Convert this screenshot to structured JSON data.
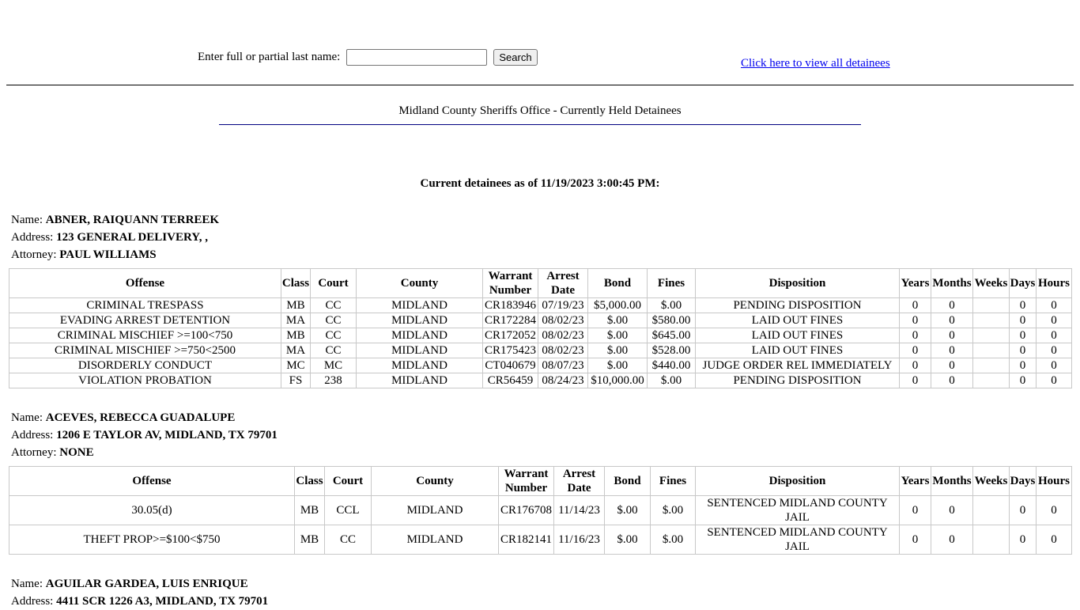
{
  "search": {
    "label": "Enter full or partial last name:",
    "value": "",
    "button": "Search"
  },
  "view_all_link": "Click here to view all detainees",
  "page_title": "Midland County Sheriffs Office - Currently Held Detainees",
  "as_of": "Current detainees as of 11/19/2023 3:00:45 PM:",
  "labels": {
    "name": "Name:",
    "address": "Address:",
    "attorney": "Attorney:"
  },
  "columns": [
    "Offense",
    "Class",
    "Court",
    "County",
    "Warrant Number",
    "Arrest Date",
    "Bond",
    "Fines",
    "Disposition",
    "Years",
    "Months",
    "Weeks",
    "Days",
    "Hours"
  ],
  "detainees": [
    {
      "name": "ABNER, RAIQUANN TERREEK",
      "address": "123 GENERAL DELIVERY, ,",
      "attorney": "PAUL WILLIAMS",
      "charges": [
        [
          "CRIMINAL TRESPASS",
          "MB",
          "CC",
          "MIDLAND",
          "CR183946",
          "07/19/23",
          "$5,000.00",
          "$.00",
          "PENDING DISPOSITION",
          "0",
          "0",
          "",
          "0",
          "0"
        ],
        [
          "EVADING ARREST DETENTION",
          "MA",
          "CC",
          "MIDLAND",
          "CR172284",
          "08/02/23",
          "$.00",
          "$580.00",
          "LAID OUT FINES",
          "0",
          "0",
          "",
          "0",
          "0"
        ],
        [
          "CRIMINAL MISCHIEF >=100<750",
          "MB",
          "CC",
          "MIDLAND",
          "CR172052",
          "08/02/23",
          "$.00",
          "$645.00",
          "LAID OUT FINES",
          "0",
          "0",
          "",
          "0",
          "0"
        ],
        [
          "CRIMINAL MISCHIEF >=750<2500",
          "MA",
          "CC",
          "MIDLAND",
          "CR175423",
          "08/02/23",
          "$.00",
          "$528.00",
          "LAID OUT FINES",
          "0",
          "0",
          "",
          "0",
          "0"
        ],
        [
          "DISORDERLY CONDUCT",
          "MC",
          "MC",
          "MIDLAND",
          "CT040679",
          "08/07/23",
          "$.00",
          "$440.00",
          "JUDGE ORDER REL IMMEDIATELY",
          "0",
          "0",
          "",
          "0",
          "0"
        ],
        [
          "VIOLATION PROBATION",
          "FS",
          "238",
          "MIDLAND",
          "CR56459",
          "08/24/23",
          "$10,000.00",
          "$.00",
          "PENDING DISPOSITION",
          "0",
          "0",
          "",
          "0",
          "0"
        ]
      ]
    },
    {
      "name": "ACEVES, REBECCA GUADALUPE",
      "address": "1206 E TAYLOR AV, MIDLAND, TX 79701",
      "attorney": "NONE",
      "charges": [
        [
          "30.05(d)",
          "MB",
          "CCL",
          "MIDLAND",
          "CR176708",
          "11/14/23",
          "$.00",
          "$.00",
          "SENTENCED MIDLAND COUNTY JAIL",
          "0",
          "0",
          "",
          "0",
          "0"
        ],
        [
          "THEFT PROP>=$100<$750",
          "MB",
          "CC",
          "MIDLAND",
          "CR182141",
          "11/16/23",
          "$.00",
          "$.00",
          "SENTENCED MIDLAND COUNTY JAIL",
          "0",
          "0",
          "",
          "0",
          "0"
        ]
      ]
    },
    {
      "name": "AGUILAR GARDEA, LUIS ENRIQUE",
      "address": "4411 SCR 1226 A3, MIDLAND, TX 79701"
    }
  ]
}
